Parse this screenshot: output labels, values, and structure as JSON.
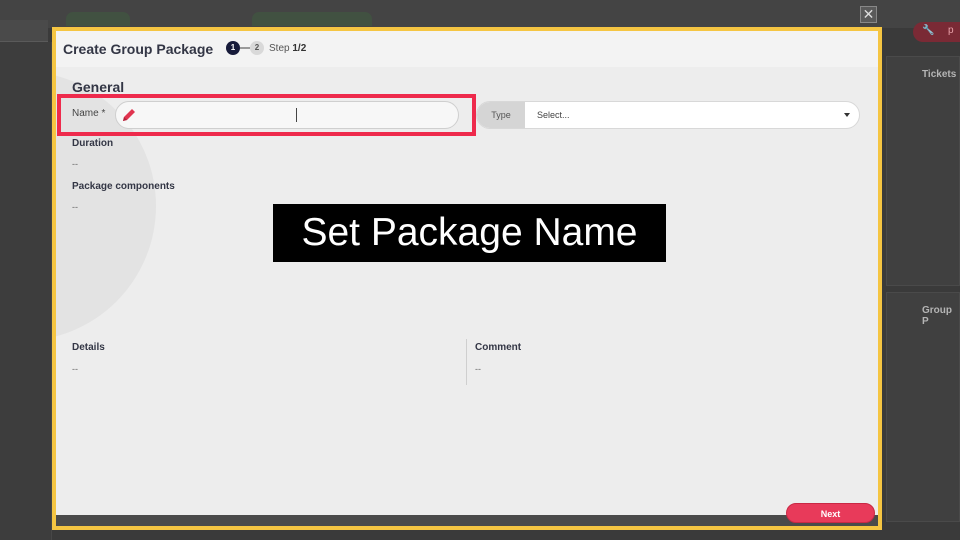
{
  "background": {
    "right_panel_title": "Tickets",
    "right_panel_title_2": "Group P",
    "close_glyph": "✕",
    "pill_icons": [
      "wrench-icon",
      "p"
    ]
  },
  "modal": {
    "title": "Create Group Package",
    "steps": [
      "1",
      "2"
    ],
    "step_prefix": "Step",
    "step_value": "1/2"
  },
  "general": {
    "section_title": "General",
    "name_label": "Name *",
    "name_value": "",
    "type_label": "Type",
    "type_value": "Select...",
    "duration_title": "Duration",
    "duration_value": "--",
    "components_title": "Package components",
    "components_value": "--"
  },
  "details": {
    "details_title": "Details",
    "details_value": "--",
    "comment_title": "Comment",
    "comment_value": "--"
  },
  "overlay": {
    "caption": "Set Package Name"
  },
  "actions": {
    "next_label": "Next"
  },
  "colors": {
    "highlight": "#ee2a4c",
    "modal_border": "#f5c542",
    "accent": "#e83a5a",
    "step_active": "#171b3a"
  }
}
